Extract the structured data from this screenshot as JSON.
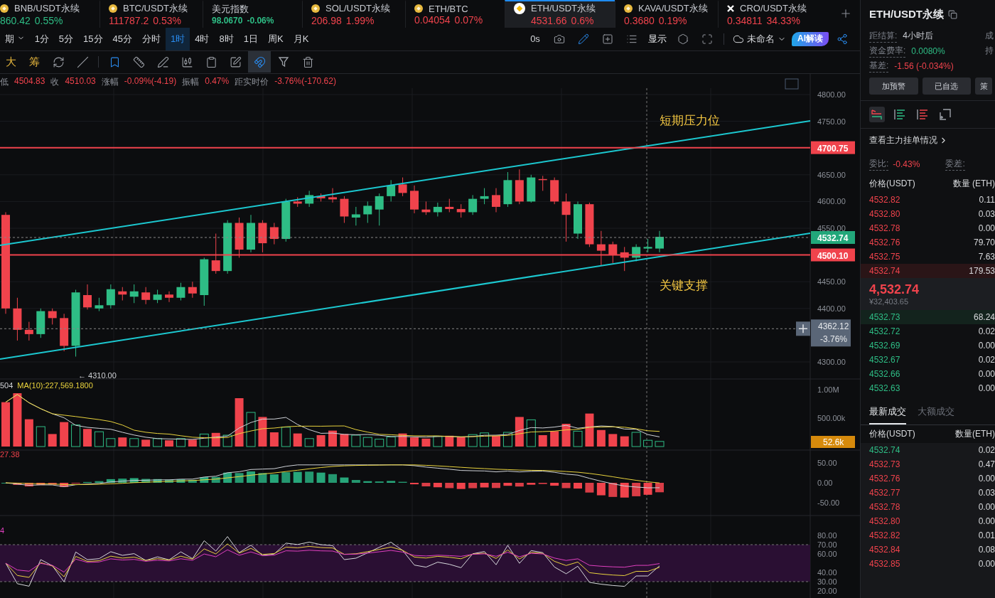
{
  "tickers": [
    {
      "symbol": "BNB/USDT永续",
      "price": "860.42",
      "change": "0.55%",
      "color": "#2ebd85",
      "kind": "coin",
      "selected": false
    },
    {
      "symbol": "BTC/USDT永续",
      "price": "111787.2",
      "change": "0.53%",
      "color": "#f0434c",
      "kind": "coin",
      "selected": false
    },
    {
      "symbol": "美元指数",
      "price": "98.0670",
      "change": "-0.06%",
      "color": "#2ebd85",
      "kind": "index",
      "selected": false
    },
    {
      "symbol": "SOL/USDT永续",
      "price": "206.98",
      "change": "1.99%",
      "color": "#f0434c",
      "kind": "coin",
      "selected": false
    },
    {
      "symbol": "ETH/BTC",
      "price": "0.04054",
      "change": "0.07%",
      "color": "#f0434c",
      "kind": "coin",
      "selected": false
    },
    {
      "symbol": "ETH/USDT永续",
      "price": "4531.66",
      "change": "0.6%",
      "color": "#f0434c",
      "kind": "coin-large",
      "selected": true
    },
    {
      "symbol": "KAVA/USDT永续",
      "price": "0.3680",
      "change": "0.19%",
      "color": "#f0434c",
      "kind": "coin",
      "selected": false
    },
    {
      "symbol": "CRO/USDT永续",
      "price": "0.34811",
      "change": "34.33%",
      "color": "#f0434c",
      "kind": "cross",
      "selected": false
    }
  ],
  "period_bar": {
    "period_menu": "期",
    "periods": [
      {
        "label": "1分",
        "selected": false
      },
      {
        "label": "5分",
        "selected": false
      },
      {
        "label": "15分",
        "selected": false
      },
      {
        "label": "45分",
        "selected": false
      },
      {
        "label": "分时",
        "selected": false
      },
      {
        "label": "1时",
        "selected": true
      },
      {
        "label": "4时",
        "selected": false
      },
      {
        "label": "8时",
        "selected": false
      },
      {
        "label": "1日",
        "selected": false
      },
      {
        "label": "周K",
        "selected": false
      },
      {
        "label": "月K",
        "selected": false
      }
    ],
    "countdown": "0s",
    "display": "显示",
    "layout_name": "未命名",
    "ai_button": "AI解读"
  },
  "drawing_tools": [
    {
      "kind": "text",
      "label": "大",
      "selected": false
    },
    {
      "kind": "text",
      "label": "筹",
      "selected": false
    },
    {
      "kind": "rotate",
      "selected": false
    },
    {
      "kind": "line",
      "selected": false
    },
    {
      "kind": "bookmark",
      "selected": false
    },
    {
      "kind": "ruler",
      "selected": false
    },
    {
      "kind": "pen",
      "selected": false
    },
    {
      "kind": "candles",
      "selected": false
    },
    {
      "kind": "clipboard",
      "selected": false
    },
    {
      "kind": "edit",
      "selected": false
    },
    {
      "kind": "magnet",
      "selected": true
    },
    {
      "kind": "filter",
      "selected": false
    },
    {
      "kind": "trash",
      "selected": false
    }
  ],
  "info_line": [
    {
      "label": "低",
      "value": "4504.83"
    },
    {
      "label": "收",
      "value": "4510.03"
    },
    {
      "label": "涨幅",
      "value": "-0.09%(-4.19)"
    },
    {
      "label": "振幅",
      "value": "0.47%"
    },
    {
      "label": "距实时价",
      "value": "-3.76%(-170.62)"
    }
  ],
  "chart": {
    "price_ticks": [
      "4800.00",
      "4750.00",
      "4650.00",
      "4600.00",
      "4550.00",
      "4450.00",
      "4400.00",
      "4300.00"
    ],
    "resistance": {
      "price": "4700.75",
      "note": "短期压力位"
    },
    "support": {
      "price": "4500.10",
      "note": "关键支撑"
    },
    "last_price": "4532.74",
    "cursor": {
      "price": "4362.12",
      "change": "-3.76%"
    },
    "low_marker": "← 4310.00",
    "volume_legend": {
      "value": "504",
      "ma": "MA(10):227,569.1800"
    },
    "volume_ticks": [
      "1.00M",
      "500.00k"
    ],
    "volume_tag": "52.6k",
    "macd_legend": "27.38",
    "macd_ticks": [
      "50.00",
      "0.00",
      "-50.00"
    ],
    "rsi_legend": "4",
    "rsi_ticks": [
      "80.00",
      "70.00",
      "60.00",
      "40.00",
      "30.00",
      "20.00"
    ]
  },
  "side_panel": {
    "title": "ETH/USDT永续",
    "stats": [
      {
        "label": "距结算:",
        "value": "4小时后",
        "color": "#c9ccd2"
      },
      {
        "label": "资金费率:",
        "value": "0.0080%",
        "color": "#2ebd85"
      },
      {
        "label": "基差:",
        "value": "-1.56 (-0.034%)",
        "color": "#f0434c"
      }
    ],
    "stats_right": [
      "成",
      "持"
    ],
    "buttons": [
      "加预警",
      "已自选",
      "策"
    ],
    "view_modes": [
      {
        "kind": "both",
        "selected": true
      },
      {
        "kind": "bids",
        "selected": false
      },
      {
        "kind": "asks",
        "selected": false
      },
      {
        "kind": "custom",
        "selected": false
      }
    ],
    "major_orders_link": "查看主力挂单情况",
    "ratio_label": "委比:",
    "ratio_value": "-0.43%",
    "diff_label": "委差:",
    "book_headers": [
      "价格(USDT)",
      "数量 (ETH)"
    ],
    "asks": [
      {
        "price": "4532.82",
        "qty": "0.11",
        "highlighted": false
      },
      {
        "price": "4532.80",
        "qty": "0.03",
        "highlighted": false
      },
      {
        "price": "4532.78",
        "qty": "0.00",
        "highlighted": false
      },
      {
        "price": "4532.76",
        "qty": "79.70",
        "highlighted": false
      },
      {
        "price": "4532.75",
        "qty": "7.63",
        "highlighted": false
      },
      {
        "price": "4532.74",
        "qty": "179.53",
        "highlighted": true
      }
    ],
    "last": "4,532.74",
    "last_cny": "¥32,403.65",
    "bids": [
      {
        "price": "4532.73",
        "qty": "68.24",
        "highlighted": true
      },
      {
        "price": "4532.72",
        "qty": "0.02",
        "highlighted": false
      },
      {
        "price": "4532.69",
        "qty": "0.00",
        "highlighted": false
      },
      {
        "price": "4532.67",
        "qty": "0.02",
        "highlighted": false
      },
      {
        "price": "4532.66",
        "qty": "0.00",
        "highlighted": false
      },
      {
        "price": "4532.63",
        "qty": "0.00",
        "highlighted": false
      }
    ],
    "trade_tabs": [
      {
        "label": "最新成交",
        "selected": true
      },
      {
        "label": "大额成交",
        "selected": false
      }
    ],
    "trade_headers": [
      "价格(USDT)",
      "数量(ETH)"
    ],
    "trades": [
      {
        "price": "4532.74",
        "qty": "0.02",
        "color": "#2ebd85"
      },
      {
        "price": "4532.73",
        "qty": "0.47",
        "color": "#f0434c"
      },
      {
        "price": "4532.76",
        "qty": "0.00",
        "color": "#f0434c"
      },
      {
        "price": "4532.77",
        "qty": "0.03",
        "color": "#f0434c"
      },
      {
        "price": "4532.78",
        "qty": "0.00",
        "color": "#f0434c"
      },
      {
        "price": "4532.80",
        "qty": "0.00",
        "color": "#f0434c"
      },
      {
        "price": "4532.82",
        "qty": "0.01",
        "color": "#f0434c"
      },
      {
        "price": "4532.84",
        "qty": "0.08",
        "color": "#f0434c"
      },
      {
        "price": "4532.85",
        "qty": "0.00",
        "color": "#f0434c"
      }
    ]
  }
}
